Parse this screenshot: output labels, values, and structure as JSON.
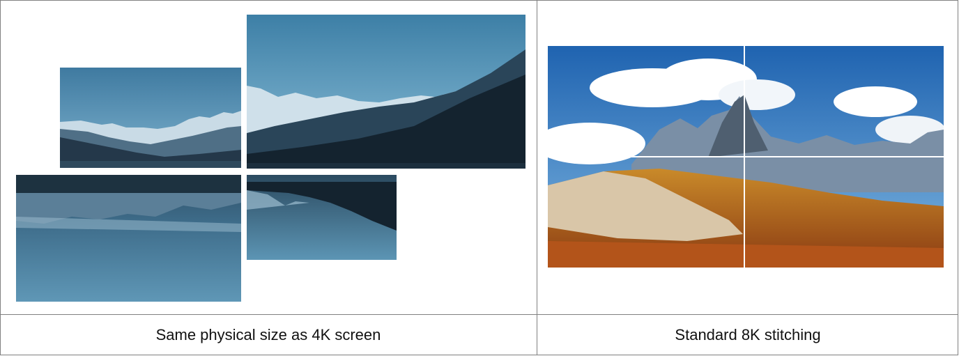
{
  "captions": {
    "left": "Same physical size as 4K screen",
    "right": "Standard 8K stitching"
  },
  "left_cell": {
    "image": "mountain-lake-split-into-four-panels",
    "panels": 4
  },
  "right_cell": {
    "image": "dolomites-peak-landscape-2x2-grid",
    "grid": "2x2"
  },
  "colors": {
    "border": "#808080",
    "sky_dark": "#3f7ea3",
    "sky_light": "#7fb6d4",
    "mountain": "#1b3346",
    "meadow": "#d4882a"
  }
}
